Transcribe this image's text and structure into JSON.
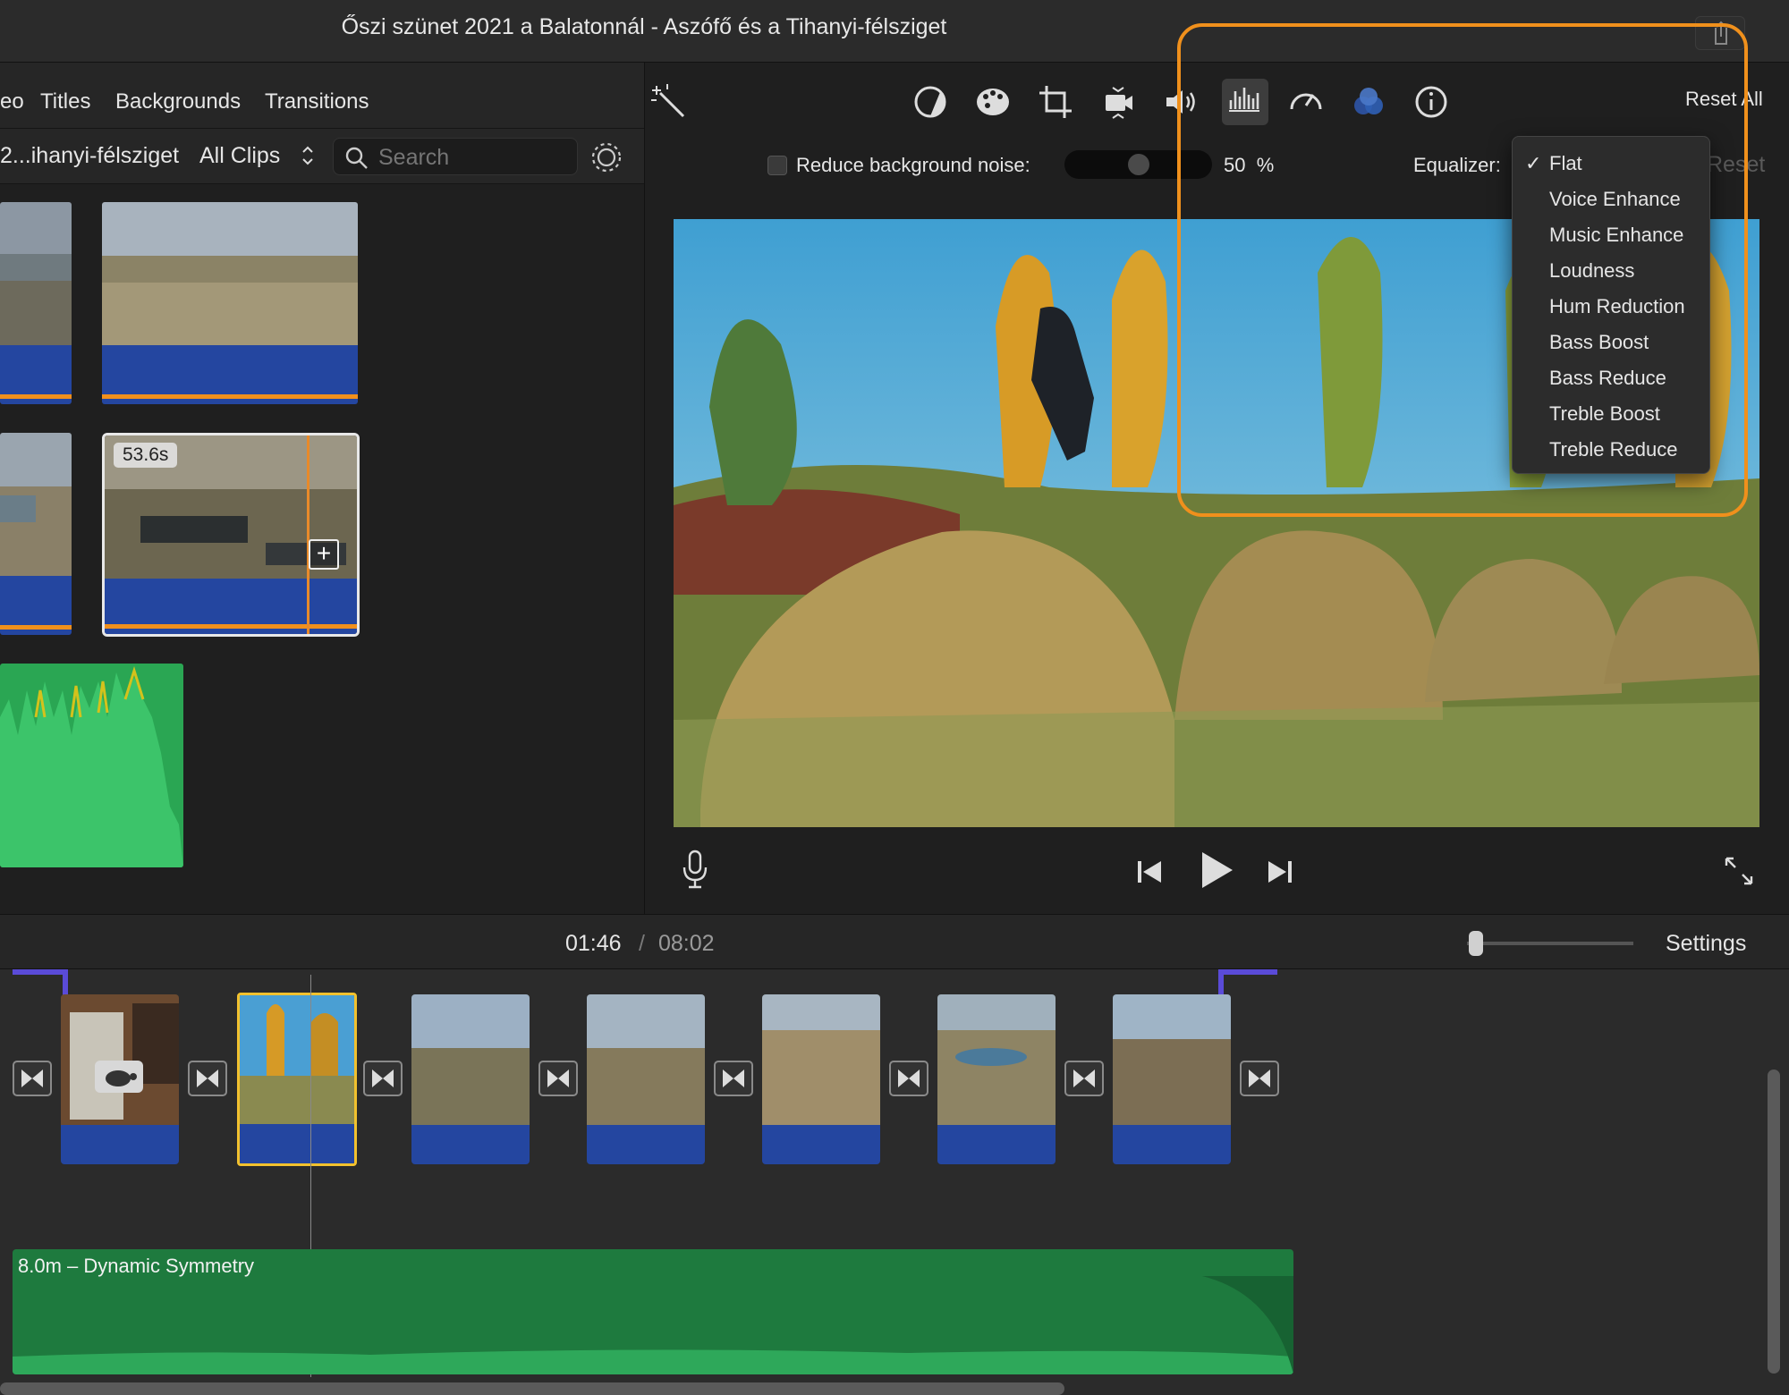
{
  "window": {
    "title": "Őszi szünet 2021 a Balatonnál - Aszófő és a Tihanyi-félsziget"
  },
  "browser": {
    "tabs": [
      "eo",
      "Titles",
      "Backgrounds",
      "Transitions"
    ],
    "library_name": "2...ihanyi-félsziget",
    "filter": "All Clips",
    "search_placeholder": "Search",
    "clip_duration": "53.6s"
  },
  "viewer": {
    "reset_all": "Reset All",
    "noise_label": "Reduce background noise:",
    "noise_value": "50",
    "noise_unit": "%",
    "noise_level": 0.5,
    "equalizer_label": "Equalizer:",
    "reset_label": "Reset",
    "equalizer_options": [
      "Flat",
      "Voice Enhance",
      "Music Enhance",
      "Loudness",
      "Hum Reduction",
      "Bass Boost",
      "Bass Reduce",
      "Treble Boost",
      "Treble Reduce"
    ],
    "equalizer_selected": "Flat"
  },
  "timeline": {
    "current_time": "01:46",
    "separator": "/",
    "total_time": "08:02",
    "settings_label": "Settings",
    "music_track": "8.0m – Dynamic Symmetry"
  },
  "colors": {
    "highlight": "#f0901c",
    "audio_blue": "#2446a0",
    "music_green": "#1e7a3e",
    "selected_clip": "#f2c12e"
  }
}
